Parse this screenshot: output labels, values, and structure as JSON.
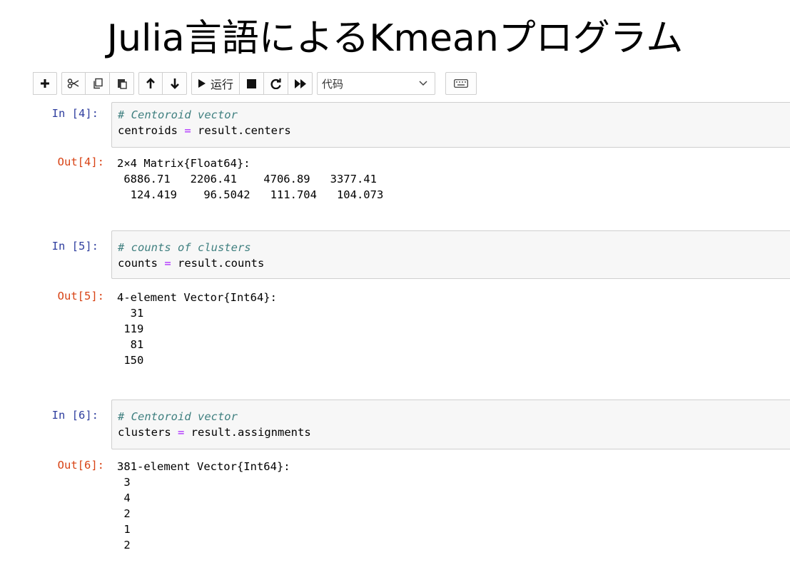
{
  "title": "Julia言語によるKmeanプログラム",
  "toolbar": {
    "add_icon": "plus-icon",
    "cut_icon": "scissors-icon",
    "copy_icon": "copy-icon",
    "paste_icon": "paste-icon",
    "move_up_icon": "arrow-up-icon",
    "move_down_icon": "arrow-down-icon",
    "run_label": "运行",
    "stop_icon": "stop-icon",
    "restart_icon": "restart-icon",
    "fast_forward_icon": "fast-forward-icon",
    "cell_type_value": "代码",
    "keyboard_icon": "keyboard-icon"
  },
  "cells": [
    {
      "in_prompt": "In  [4]:",
      "comment": "# Centoroid vector",
      "code_lhs": "centroids ",
      "code_op": "=",
      "code_rhs": " result.centers",
      "out_prompt": "Out[4]:",
      "output_lines": [
        "2×4 Matrix{Float64}:",
        " 6886.71   2206.41    4706.89   3377.41",
        "  124.419    96.5042   111.704   104.073"
      ]
    },
    {
      "in_prompt": "In  [5]:",
      "comment": "# counts of clusters",
      "code_lhs": "counts ",
      "code_op": "=",
      "code_rhs": " result.counts",
      "out_prompt": "Out[5]:",
      "output_lines": [
        "4-element Vector{Int64}:",
        "  31",
        " 119",
        "  81",
        " 150"
      ]
    },
    {
      "in_prompt": "In  [6]:",
      "comment": "# Centoroid vector",
      "code_lhs": "clusters ",
      "code_op": "=",
      "code_rhs": " result.assignments",
      "out_prompt": "Out[6]:",
      "output_lines": [
        "381-element Vector{Int64}:",
        " 3",
        " 4",
        " 2",
        " 1",
        " 2"
      ]
    }
  ]
}
